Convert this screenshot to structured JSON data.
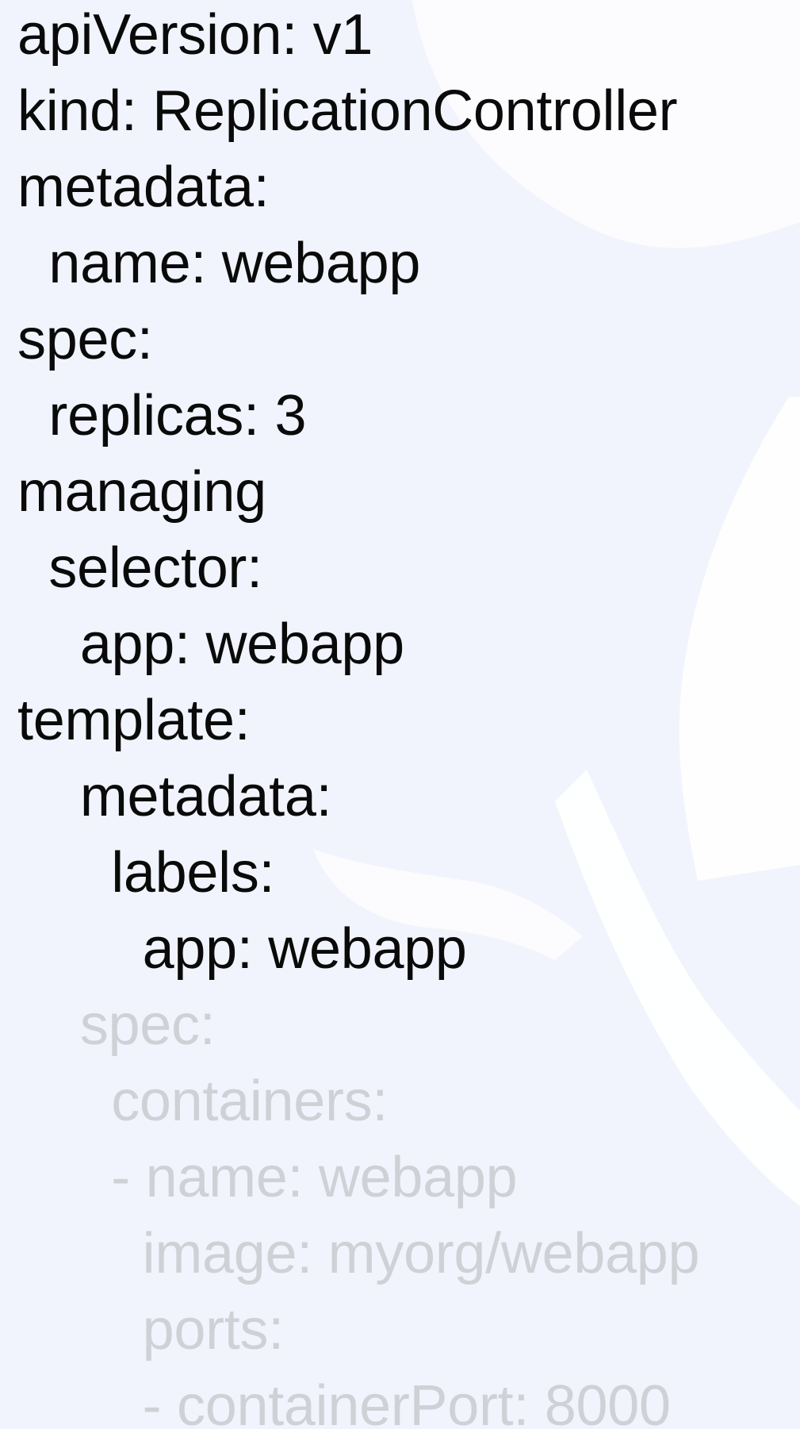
{
  "document": {
    "lines": [
      {
        "text": "apiVersion: v1"
      },
      {
        "text": "kind: ReplicationController"
      },
      {
        "text": "metadata:"
      },
      {
        "text": "  name: webapp"
      },
      {
        "text": "spec:"
      },
      {
        "text": "  replicas: 3"
      },
      {
        "text": "managing"
      },
      {
        "text": "  selector:"
      },
      {
        "text": "    app: webapp"
      },
      {
        "text": "template:"
      },
      {
        "text": "    metadata:"
      },
      {
        "text": "      labels:"
      },
      {
        "text": "        app: webapp"
      },
      {
        "text": "    spec:"
      },
      {
        "text": "      containers:"
      },
      {
        "text": "      - name: webapp"
      },
      {
        "text": "        image: myorg/webapp"
      },
      {
        "text": "        ports:"
      },
      {
        "text": "        - containerPort: 8000"
      }
    ]
  },
  "colors": {
    "background": "#f1f4fc",
    "text": "#0a0a0a",
    "faded_text": "#cfd1d6",
    "watermark": "#ffffff"
  },
  "icons": {
    "watermark": "helm-like-logo-watermark"
  }
}
